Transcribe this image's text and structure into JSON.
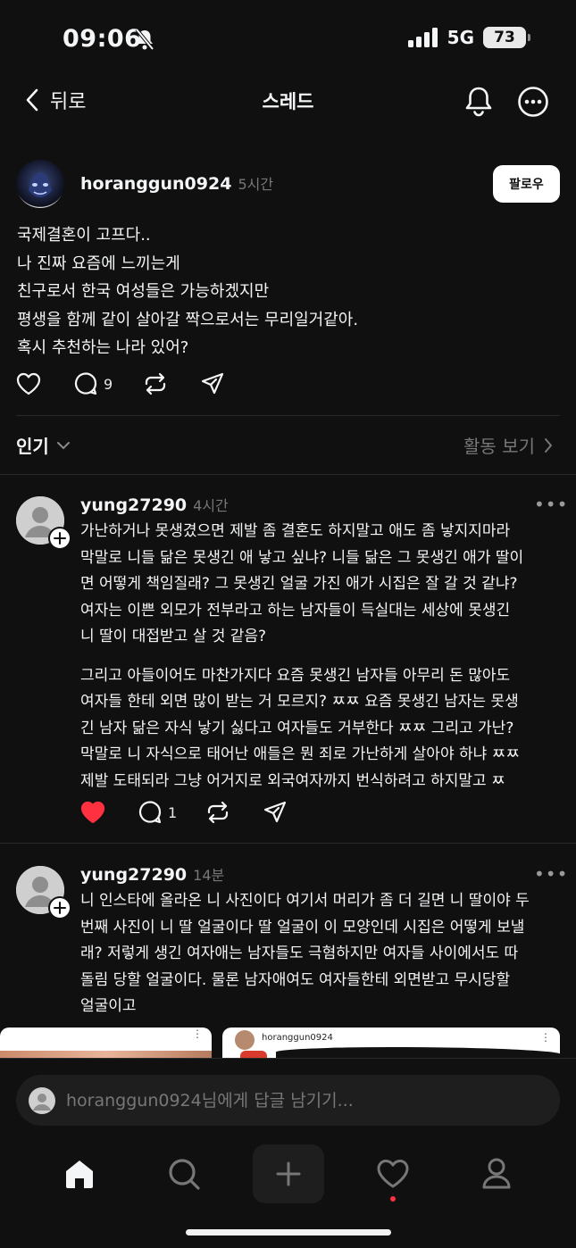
{
  "status_bar": {
    "time": "09:06",
    "network": "5G",
    "battery": "73"
  },
  "header": {
    "back_label": "뒤로",
    "title": "스레드"
  },
  "post": {
    "username": "horanggun0924",
    "time": "5시간",
    "follow_label": "팔로우",
    "lines": [
      "국제결혼이 고프다..",
      "나 진짜 요즘에 느끼는게",
      "친구로서 한국 여성들은 가능하겠지만",
      "평생을 함께 같이 살아갈 짝으로서는 무리일거같아.",
      "혹시 추천하는 나라 있어?"
    ],
    "reply_count": "9"
  },
  "sort": {
    "label": "인기",
    "activity_label": "활동 보기"
  },
  "replies": [
    {
      "username": "yung27290",
      "time": "4시간",
      "paragraph1": [
        "가난하거나 못생겼으면 제발 좀 결혼도 하지말고 애도 좀 낳지지마라",
        "막말로 니들 닮은 못생긴 애 낳고 싶냐? 니들 닮은 그 못생긴 애가 딸이",
        "면 어떻게 책임질래? 그 못생긴 얼굴 가진 애가 시집은 잘 갈 것 같냐?",
        "여자는 이쁜 외모가 전부라고 하는 남자들이 득실대는 세상에 못생긴",
        "니 딸이 대접받고 살 것 같음?"
      ],
      "paragraph2": [
        "그리고 아들이어도 마찬가지다 요즘 못생긴 남자들 아무리 돈 많아도",
        "여자들 한테 외면 많이 받는 거 모르지? ㅉㅉ 요즘 못생긴 남자는 못생",
        "긴 남자 닮은 자식 낳기 싫다고 여자들도 거부한다 ㅉㅉ 그리고 가난?",
        "막말로 니 자식으로 태어난 애들은 뭔 죄로 가난하게 살아야 하냐 ㅉㅉ",
        "제발 도태되라 그냥 어거지로 외국여자까지 번식하려고 하지말고 ㅉ"
      ],
      "reply_count": "1",
      "liked": true
    },
    {
      "username": "yung27290",
      "time": "14분",
      "paragraph1": [
        "니 인스타에 올라온 니 사진이다 여기서 머리가 좀 더 길면 니 딸이야 두",
        "번째 사진이 니 딸 얼굴이다 딸 얼굴이 이 모양인데 시집은 어떻게 보낼",
        "래? 저렇게 생긴 여자애는 남자들도 극혐하지만 여자들 사이에서도 따",
        "돌림 당할 얼굴이다. 물론 남자애여도 여자들한테 외면받고 무시당할",
        "얼굴이고"
      ],
      "attachment_username": "horanggun0924"
    }
  ],
  "reply_bar": {
    "placeholder": "horanggun0924님에게 답글 남기기..."
  },
  "tabs": [
    "home",
    "search",
    "create",
    "activity",
    "profile"
  ],
  "colors": {
    "background": "#101010",
    "like_red": "#ff3040",
    "muted": "#777777"
  }
}
